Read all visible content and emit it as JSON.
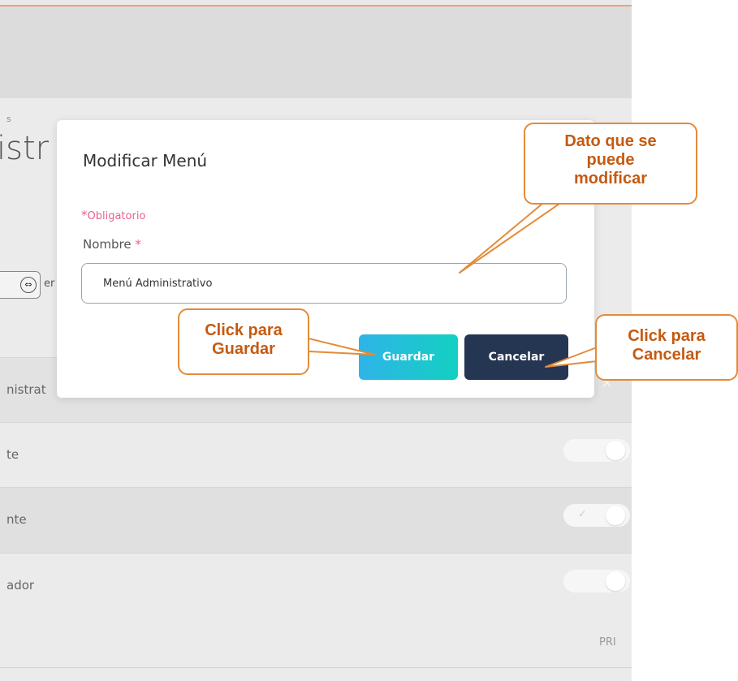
{
  "background": {
    "breadcrumb_fragment": "s",
    "title_fragment": "istr",
    "entries_fragment": "er",
    "rows": [
      {
        "label": "nistrat"
      },
      {
        "label": "te"
      },
      {
        "label": "nte"
      },
      {
        "label": "ador"
      }
    ],
    "footer_fragment": "PRI",
    "close_glyph": "✕"
  },
  "modal": {
    "title": "Modificar Menú",
    "required_star": "*",
    "required_note": "Obligatorio",
    "name_label": "Nombre",
    "name_star": "*",
    "name_value": "Menú Administrativo",
    "save_label": "Guardar",
    "cancel_label": "Cancelar"
  },
  "callouts": {
    "dato": [
      "Dato que se",
      "puede",
      "modificar"
    ],
    "guardar": [
      "Click para",
      "Guardar"
    ],
    "cancelar": [
      "Click para",
      "Cancelar"
    ]
  },
  "colors": {
    "accent_line": "#f0a07a",
    "required_pink": "#e9618f",
    "save_gradient_start": "#2fb4e8",
    "save_gradient_end": "#13d0c2",
    "cancel_bg": "#253653",
    "callout_border": "#e38b39",
    "callout_text": "#c55a11"
  }
}
